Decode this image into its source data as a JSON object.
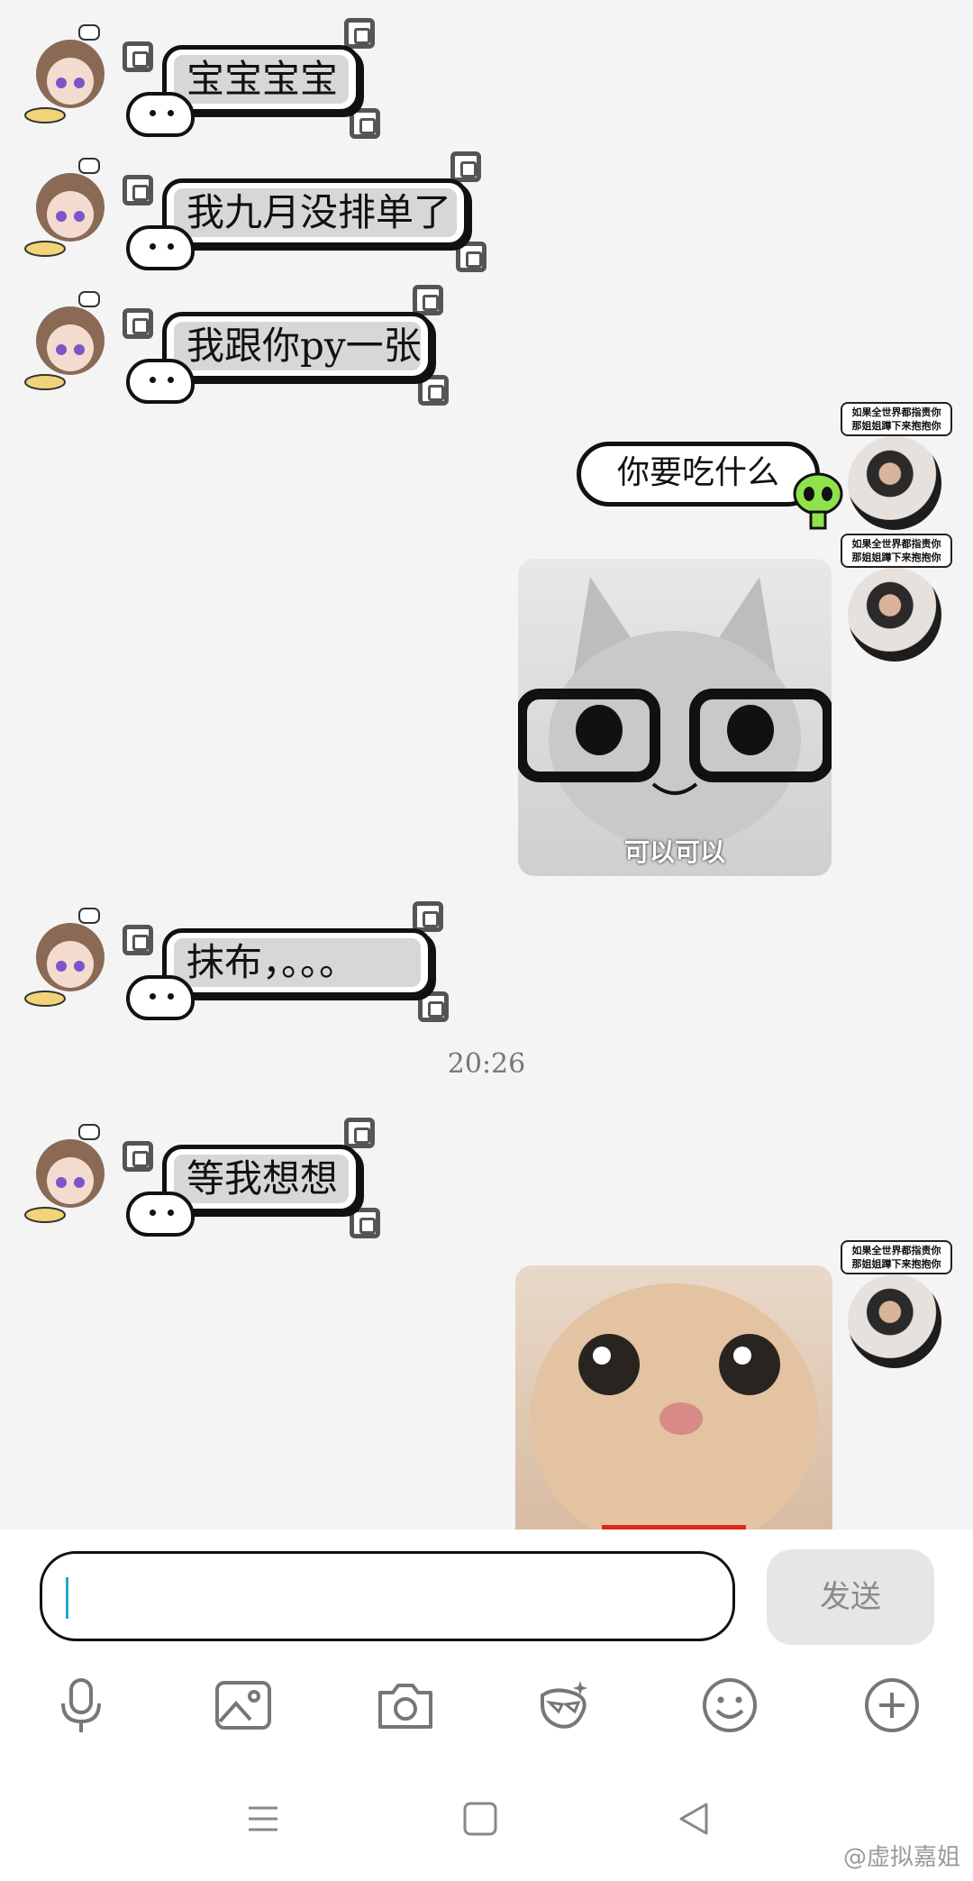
{
  "messages_in": [
    {
      "text": "宝宝宝宝"
    },
    {
      "text": "我九月没排单了"
    },
    {
      "text": "我跟你py一张"
    },
    {
      "text": "抹布，。。。"
    },
    {
      "text": "等我想想"
    }
  ],
  "messages_out": {
    "speech": "你要吃什么",
    "sticker_cat1_caption": "可以可以",
    "avatar_caption": "如果全世界都指责你\n那姐姐蹲下来抱抱你"
  },
  "timestamp": "20:26",
  "input": {
    "placeholder": "",
    "send_label": "发送"
  },
  "toolbar": [
    "mic-icon",
    "image-icon",
    "camera-icon",
    "sticker-icon",
    "emoji-icon",
    "plus-icon"
  ],
  "nav": [
    "menu-icon",
    "home-icon",
    "back-icon"
  ],
  "watermark": "@虚拟嘉姐",
  "colors": {
    "background": "#f4f4f4",
    "caret": "#2aa3d6",
    "send_bg": "#e6e6e6"
  }
}
